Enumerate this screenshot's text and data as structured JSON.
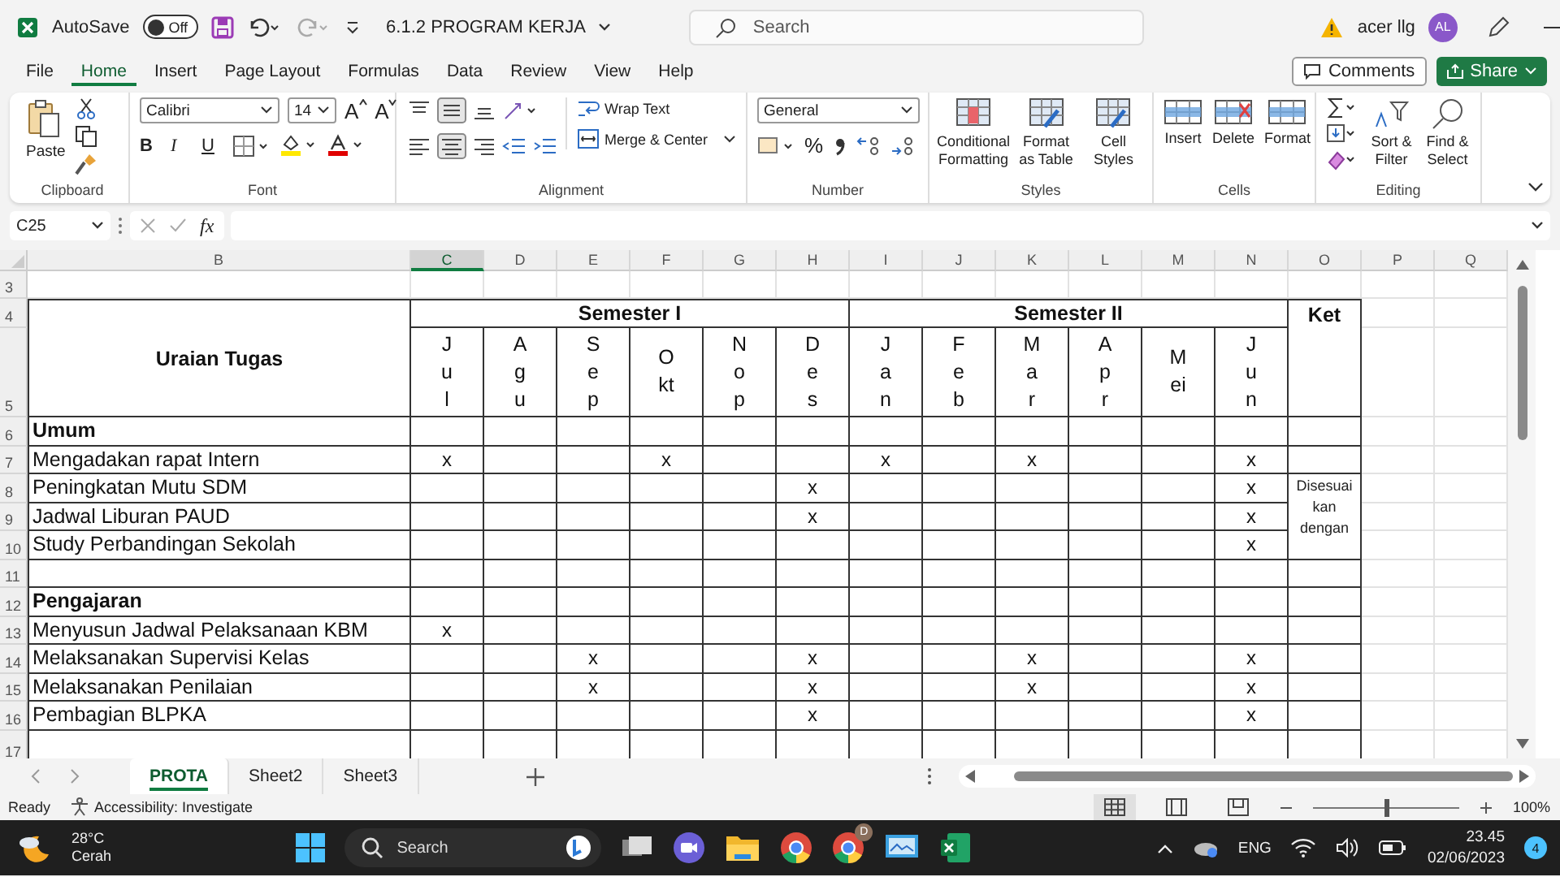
{
  "title_bar": {
    "autosave_label": "AutoSave",
    "autosave_toggle": {
      "label": "Off",
      "on": false
    },
    "file_name": "6.1.2 PROGRAM KERJA",
    "search": {
      "placeholder": "Search"
    },
    "user_name": "acer llg",
    "avatar_initials": "AL"
  },
  "menu_tabs": [
    {
      "label": "File",
      "selected": false
    },
    {
      "label": "Home",
      "selected": true
    },
    {
      "label": "Insert",
      "selected": false
    },
    {
      "label": "Page Layout",
      "selected": false
    },
    {
      "label": "Formulas",
      "selected": false
    },
    {
      "label": "Data",
      "selected": false
    },
    {
      "label": "Review",
      "selected": false
    },
    {
      "label": "View",
      "selected": false
    },
    {
      "label": "Help",
      "selected": false
    }
  ],
  "comments_button": "Comments",
  "share_button": "Share",
  "ribbon": {
    "clipboard": {
      "paste": "Paste",
      "group_label": "Clipboard"
    },
    "font": {
      "font_name": "Calibri",
      "font_size": "14",
      "grow": "A",
      "shrink": "A",
      "bold": "B",
      "italic": "I",
      "underline": "U",
      "group_label": "Font"
    },
    "alignment": {
      "wrap_text": "Wrap Text",
      "merge_center": "Merge & Center",
      "group_label": "Alignment"
    },
    "number": {
      "format": "General",
      "percent": "%",
      "group_label": "Number"
    },
    "styles": {
      "buttons": [
        "Conditional Formatting",
        "Format as Table",
        "Cell Styles"
      ],
      "group_label": "Styles"
    },
    "cells": {
      "buttons": [
        "Insert",
        "Delete",
        "Format"
      ],
      "group_label": "Cells"
    },
    "editing": {
      "buttons": [
        "Sort & Filter",
        "Find & Select"
      ],
      "group_label": "Editing"
    }
  },
  "formula_bar": {
    "name_box": "C25",
    "fx": "fx"
  },
  "sheet": {
    "columns": [
      {
        "label": "B",
        "selected": false
      },
      {
        "label": "C",
        "selected": true
      },
      {
        "label": "D",
        "selected": false
      },
      {
        "label": "E",
        "selected": false
      },
      {
        "label": "F",
        "selected": false
      },
      {
        "label": "G",
        "selected": false
      },
      {
        "label": "H",
        "selected": false
      },
      {
        "label": "I",
        "selected": false
      },
      {
        "label": "J",
        "selected": false
      },
      {
        "label": "K",
        "selected": false
      },
      {
        "label": "L",
        "selected": false
      },
      {
        "label": "M",
        "selected": false
      },
      {
        "label": "N",
        "selected": false
      },
      {
        "label": "O",
        "selected": false
      },
      {
        "label": "P",
        "selected": false
      },
      {
        "label": "Q",
        "selected": false
      }
    ],
    "top_row_numbers": [
      "3",
      "4",
      "5"
    ],
    "header": {
      "title": "Uraian Tugas",
      "note_heading": "Ket",
      "semesters": [
        {
          "label": "Semester I",
          "months": [
            "Jul",
            "Agu",
            "Sep",
            "Okt",
            "Nop",
            "Des"
          ]
        },
        {
          "label": "Semester II",
          "months": [
            "Jan",
            "Feb",
            "Mar",
            "Apr",
            "Mei",
            "Jun"
          ]
        }
      ]
    },
    "rows": [
      {
        "number": "6",
        "kind": "section",
        "label": "Umum"
      },
      {
        "number": "7",
        "kind": "task",
        "label": "Mengadakan rapat Intern",
        "cells": [
          {
            "kind": "mark",
            "text": "x"
          },
          {
            "kind": "empty"
          },
          {
            "kind": "empty"
          },
          {
            "kind": "mark",
            "text": "x"
          },
          {
            "kind": "empty"
          },
          {
            "kind": "empty"
          },
          {
            "kind": "mark",
            "text": "x"
          },
          {
            "kind": "empty"
          },
          {
            "kind": "mark",
            "text": "x"
          },
          {
            "kind": "empty"
          },
          {
            "kind": "empty"
          },
          {
            "kind": "mark",
            "text": "x"
          }
        ]
      },
      {
        "number": "8",
        "kind": "task",
        "label": "Peningkatan Mutu SDM",
        "note": "Disesuai kan dengan",
        "cells": [
          {
            "kind": "empty"
          },
          {
            "kind": "empty"
          },
          {
            "kind": "empty"
          },
          {
            "kind": "empty"
          },
          {
            "kind": "empty"
          },
          {
            "kind": "mark",
            "text": "x"
          },
          {
            "kind": "empty"
          },
          {
            "kind": "empty"
          },
          {
            "kind": "empty"
          },
          {
            "kind": "empty"
          },
          {
            "kind": "empty"
          },
          {
            "kind": "mark",
            "text": "x"
          }
        ]
      },
      {
        "number": "9",
        "kind": "task",
        "label": "Jadwal Liburan PAUD",
        "cells": [
          {
            "kind": "empty"
          },
          {
            "kind": "empty"
          },
          {
            "kind": "empty"
          },
          {
            "kind": "empty"
          },
          {
            "kind": "empty"
          },
          {
            "kind": "mark",
            "text": "x"
          },
          {
            "kind": "empty"
          },
          {
            "kind": "empty"
          },
          {
            "kind": "empty"
          },
          {
            "kind": "empty"
          },
          {
            "kind": "empty"
          },
          {
            "kind": "mark",
            "text": "x"
          }
        ]
      },
      {
        "number": "10",
        "kind": "task",
        "label": "Study Perbandingan Sekolah",
        "cells": [
          {
            "kind": "empty"
          },
          {
            "kind": "empty"
          },
          {
            "kind": "empty"
          },
          {
            "kind": "empty"
          },
          {
            "kind": "empty"
          },
          {
            "kind": "empty"
          },
          {
            "kind": "empty"
          },
          {
            "kind": "empty"
          },
          {
            "kind": "empty"
          },
          {
            "kind": "empty"
          },
          {
            "kind": "empty"
          },
          {
            "kind": "mark",
            "text": "x"
          }
        ]
      },
      {
        "number": "11",
        "kind": "blank"
      },
      {
        "number": "12",
        "kind": "section",
        "label": "Pengajaran"
      },
      {
        "number": "13",
        "kind": "task",
        "label": "Menyusun Jadwal Pelaksanaan KBM",
        "cells": [
          {
            "kind": "mark",
            "text": "x"
          },
          {
            "kind": "empty"
          },
          {
            "kind": "empty"
          },
          {
            "kind": "empty"
          },
          {
            "kind": "empty"
          },
          {
            "kind": "empty"
          },
          {
            "kind": "empty"
          },
          {
            "kind": "empty"
          },
          {
            "kind": "empty"
          },
          {
            "kind": "empty"
          },
          {
            "kind": "empty"
          },
          {
            "kind": "empty"
          }
        ]
      },
      {
        "number": "14",
        "kind": "task",
        "label": "Melaksanakan Supervisi Kelas",
        "cells": [
          {
            "kind": "empty"
          },
          {
            "kind": "empty"
          },
          {
            "kind": "mark",
            "text": "x"
          },
          {
            "kind": "empty"
          },
          {
            "kind": "empty"
          },
          {
            "kind": "mark",
            "text": "x"
          },
          {
            "kind": "empty"
          },
          {
            "kind": "empty"
          },
          {
            "kind": "mark",
            "text": "x"
          },
          {
            "kind": "empty"
          },
          {
            "kind": "empty"
          },
          {
            "kind": "mark",
            "text": "x"
          }
        ]
      },
      {
        "number": "15",
        "kind": "task",
        "label": "Melaksanakan Penilaian",
        "cells": [
          {
            "kind": "empty"
          },
          {
            "kind": "empty"
          },
          {
            "kind": "mark",
            "text": "x"
          },
          {
            "kind": "empty"
          },
          {
            "kind": "empty"
          },
          {
            "kind": "mark",
            "text": "x"
          },
          {
            "kind": "empty"
          },
          {
            "kind": "empty"
          },
          {
            "kind": "mark",
            "text": "x"
          },
          {
            "kind": "empty"
          },
          {
            "kind": "empty"
          },
          {
            "kind": "mark",
            "text": "x"
          }
        ]
      },
      {
        "number": "16",
        "kind": "task",
        "label": "Pembagian BLPKA",
        "cells": [
          {
            "kind": "empty"
          },
          {
            "kind": "empty"
          },
          {
            "kind": "empty"
          },
          {
            "kind": "empty"
          },
          {
            "kind": "empty"
          },
          {
            "kind": "mark",
            "text": "x"
          },
          {
            "kind": "empty"
          },
          {
            "kind": "empty"
          },
          {
            "kind": "empty"
          },
          {
            "kind": "empty"
          },
          {
            "kind": "empty"
          },
          {
            "kind": "mark",
            "text": "x"
          }
        ]
      },
      {
        "number": "17",
        "kind": "blank"
      }
    ]
  },
  "sheet_tabs": [
    {
      "label": "PROTA",
      "selected": true
    },
    {
      "label": "Sheet2",
      "selected": false
    },
    {
      "label": "Sheet3",
      "selected": false
    }
  ],
  "status_bar": {
    "status": "Ready",
    "accessibility": "Accessibility: Investigate",
    "zoom_slider": {
      "level": 0.5
    },
    "zoom": "100%"
  },
  "taskbar": {
    "weather_temp": "28°C",
    "weather_text": "Cerah",
    "search": "Search",
    "browser_badge": "D",
    "language": "ENG",
    "time": "23.45",
    "date": "02/06/2023",
    "notification_count": "4"
  }
}
